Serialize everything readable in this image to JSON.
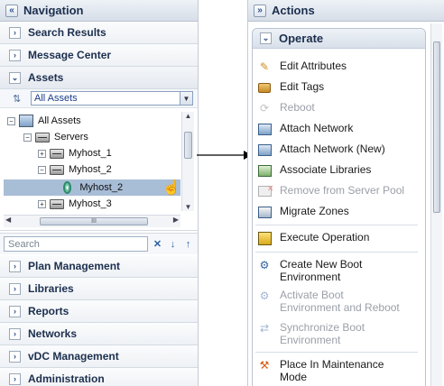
{
  "navigation": {
    "title": "Navigation",
    "sections_top": [
      {
        "label": "Search Results"
      },
      {
        "label": "Message Center"
      },
      {
        "label": "Assets"
      }
    ],
    "assets": {
      "filter_value": "All Assets",
      "tree": [
        {
          "label": "All Assets",
          "expander": "−"
        },
        {
          "label": "Servers",
          "expander": "−"
        },
        {
          "label": "Myhost_1",
          "expander": "+"
        },
        {
          "label": "Myhost_2",
          "expander": "−"
        },
        {
          "label": "Myhost_2",
          "expander": ""
        },
        {
          "label": "Myhost_3",
          "expander": "+"
        }
      ],
      "hscroll_grip": "III",
      "search_placeholder": "Search",
      "search_clear": "✕",
      "search_down": "↓",
      "search_up": "↑"
    },
    "sections_bottom": [
      {
        "label": "Plan Management"
      },
      {
        "label": "Libraries"
      },
      {
        "label": "Reports"
      },
      {
        "label": "Networks"
      },
      {
        "label": "vDC Management"
      },
      {
        "label": "Administration"
      }
    ],
    "collapse_glyph": "«",
    "closed_glyph": "›",
    "open_glyph": "⌄"
  },
  "actions": {
    "title": "Actions",
    "expand_glyph": "»",
    "group_title": "Operate",
    "items": [
      {
        "label": "Edit Attributes",
        "icon": "pencil-icon",
        "enabled": true
      },
      {
        "label": "Edit Tags",
        "icon": "tag-icon",
        "enabled": true
      },
      {
        "label": "Reboot",
        "icon": "reboot-icon",
        "enabled": false
      },
      {
        "label": "Attach Network",
        "icon": "network-icon",
        "enabled": true
      },
      {
        "label": "Attach Network (New)",
        "icon": "network-new-icon",
        "enabled": true
      },
      {
        "label": "Associate Libraries",
        "icon": "library-icon",
        "enabled": true
      },
      {
        "label": "Remove from Server Pool",
        "icon": "remove-pool-icon",
        "enabled": false
      },
      {
        "label": "Migrate Zones",
        "icon": "migrate-icon",
        "enabled": true
      },
      {
        "label": "Execute Operation",
        "icon": "execute-icon",
        "enabled": true
      },
      {
        "label": "Create New Boot Environment",
        "icon": "boot-create-icon",
        "enabled": true
      },
      {
        "label": "Activate Boot Environment and Reboot",
        "icon": "boot-activate-icon",
        "enabled": false
      },
      {
        "label": "Synchronize Boot Environment",
        "icon": "boot-sync-icon",
        "enabled": false
      },
      {
        "label": "Place In Maintenance Mode",
        "icon": "maintenance-icon",
        "enabled": true
      }
    ]
  },
  "colors": {
    "header_text": "#1c2f4e",
    "selected_row": "#a8bdd6",
    "disabled_text": "#9aa0a8",
    "link_blue": "#1a3c8a"
  }
}
